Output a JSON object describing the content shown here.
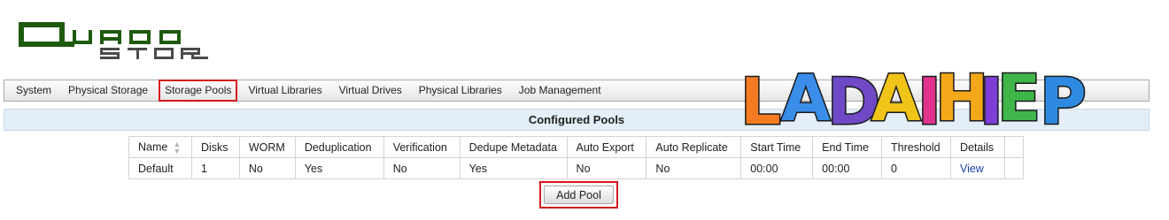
{
  "brand": {
    "logo_line1": "QUAD",
    "logo_line2": "STOR",
    "logo_color": "#1e5a0e",
    "logo_accent": "#6a6a6a"
  },
  "watermark": {
    "text": "LADAIHIEP",
    "letter_colors": [
      "#f57b22",
      "#3a8de8",
      "#6f49c6",
      "#f0c419",
      "#e0338e",
      "#f3a81a",
      "#7d3fd6",
      "#3fb54a",
      "#2e8ae0"
    ]
  },
  "nav": {
    "items": [
      {
        "label": "System"
      },
      {
        "label": "Physical Storage"
      },
      {
        "label": "Storage Pools",
        "active": true
      },
      {
        "label": "Virtual Libraries"
      },
      {
        "label": "Virtual Drives"
      },
      {
        "label": "Physical Libraries"
      },
      {
        "label": "Job Management"
      }
    ]
  },
  "section": {
    "title": "Configured Pools"
  },
  "table": {
    "columns": [
      "Name",
      "Disks",
      "WORM",
      "Deduplication",
      "Verification",
      "Dedupe Metadata",
      "Auto Export",
      "Auto Replicate",
      "Start Time",
      "End Time",
      "Threshold",
      "Details",
      ""
    ],
    "rows": [
      [
        "Default",
        "1",
        "No",
        "Yes",
        "No",
        "Yes",
        "No",
        "No",
        "00:00",
        "00:00",
        "0",
        "View",
        ""
      ]
    ]
  },
  "actions": {
    "add_pool_label": "Add Pool"
  },
  "colors": {
    "highlight": "#d3191f",
    "header_bg": "#e3eef9",
    "link": "#1a3fb0"
  }
}
